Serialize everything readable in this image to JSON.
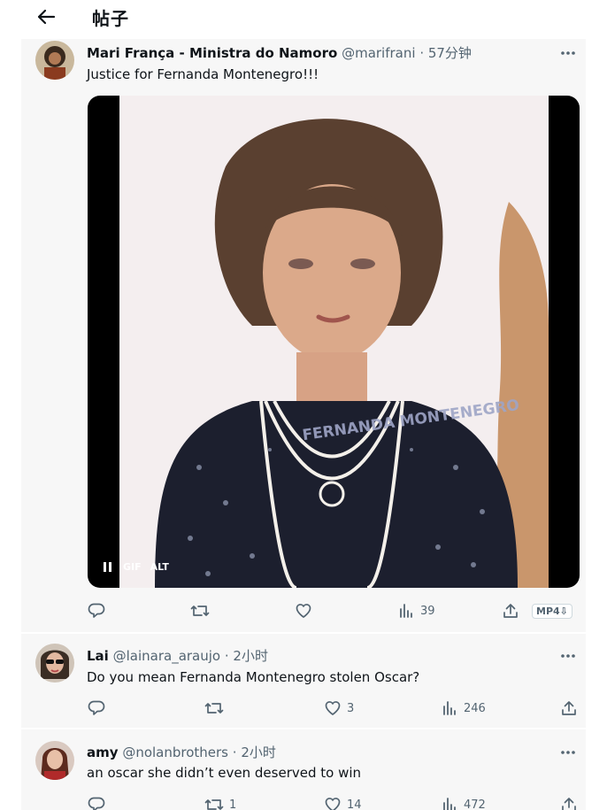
{
  "header": {
    "title": "帖子",
    "back_icon": "arrow-left-icon"
  },
  "main_post": {
    "author_name": "Mari França - Ministra do Namoro",
    "handle": "@marifrani",
    "time": "· 57分钟",
    "text": "Justice for Fernanda Montenegro!!!",
    "media": {
      "type": "gif",
      "watermark": "FERNANDA MONTENEGRO",
      "gif_badge": "GIF",
      "alt_badge": "ALT"
    },
    "actions": {
      "reply_count": "",
      "repost_count": "",
      "like_count": "",
      "views": "39",
      "download_label": "MP4⇩"
    }
  },
  "replies": [
    {
      "author_name": "Lai",
      "handle": "@lainara_araujo",
      "time": "· 2小时",
      "text": "Do you mean Fernanda Montenegro stolen Oscar?",
      "actions": {
        "reply_count": "",
        "repost_count": "",
        "like_count": "3",
        "views": "246"
      }
    },
    {
      "author_name": "amy",
      "handle": "@nolanbrothers",
      "time": "· 2小时",
      "text": "an oscar she didn’t even deserved to win",
      "actions": {
        "reply_count": "",
        "repost_count": "1",
        "like_count": "14",
        "views": "472"
      }
    }
  ],
  "colors": {
    "text": "#0f1419",
    "secondary": "#536471",
    "card_bg": "#f7f7f7"
  }
}
